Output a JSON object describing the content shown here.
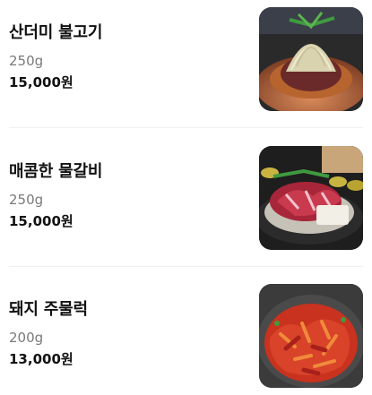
{
  "menu": {
    "items": [
      {
        "name": "산더미 불고기",
        "weight": "250g",
        "price": "15,000원"
      },
      {
        "name": "매콤한 물갈비",
        "weight": "250g",
        "price": "15,000원"
      },
      {
        "name": "돼지 주물럭",
        "weight": "200g",
        "price": "13,000원"
      }
    ]
  }
}
